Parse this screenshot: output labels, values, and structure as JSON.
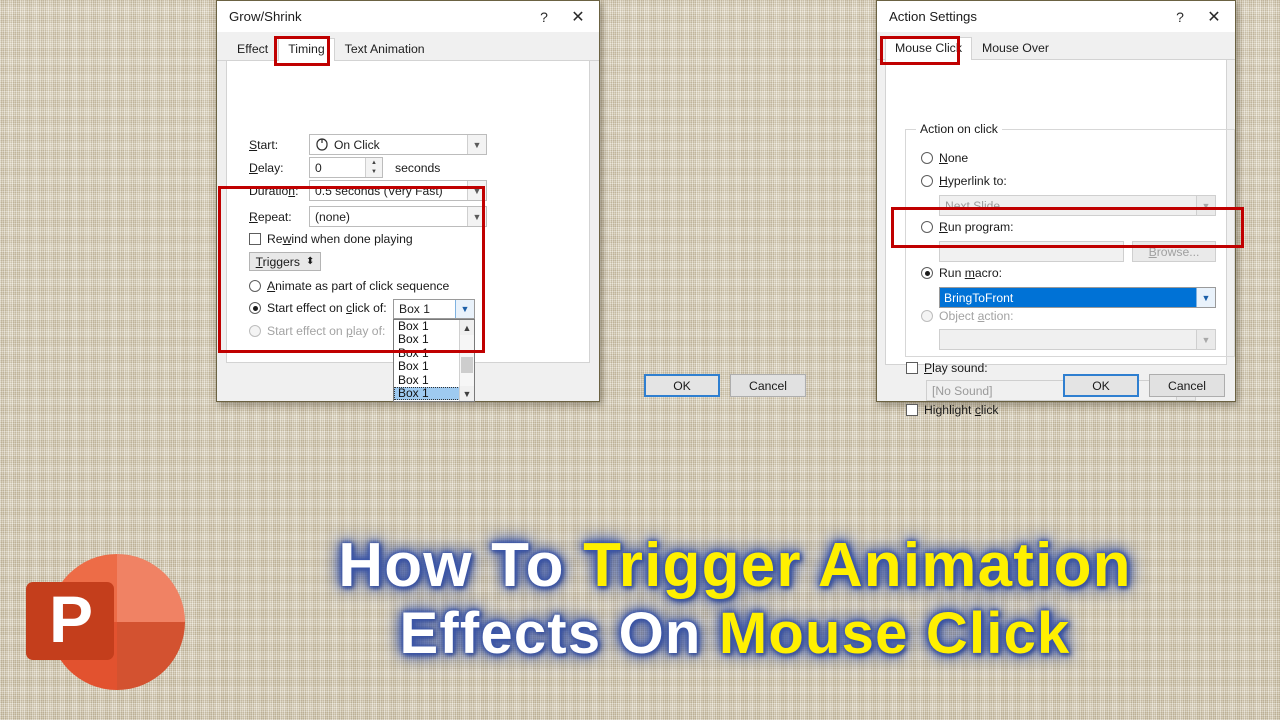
{
  "background": {
    "color": "#d7cdb6",
    "texture": "linen-burlap"
  },
  "dialog_grow_shrink": {
    "title": "Grow/Shrink",
    "help_icon": "?",
    "close_icon": "✕",
    "tabs": [
      {
        "label": "Effect",
        "active": false
      },
      {
        "label": "Timing",
        "active": true
      },
      {
        "label": "Text Animation",
        "active": false
      }
    ],
    "fields": {
      "start_label": "Start:",
      "start_value": "On Click",
      "start_icon": "mouse-icon",
      "delay_label": "Delay:",
      "delay_value": "0",
      "delay_units": "seconds",
      "duration_label": "Duration:",
      "duration_value": "0.5 seconds (Very Fast)",
      "repeat_label": "Repeat:",
      "repeat_value": "(none)",
      "rewind_label": "Rewind when done playing",
      "rewind_checked": false
    },
    "triggers": {
      "button_label": "Triggers",
      "button_glyph": "⬍",
      "option_sequence": "Animate as part of click sequence",
      "option_sequence_selected": false,
      "option_click_of": "Start effect on click of:",
      "option_click_of_selected": true,
      "click_of_value": "Box 1",
      "option_play_of": "Start effect on play of:",
      "option_play_of_selected": false,
      "option_play_of_disabled": true,
      "dropdown_items": [
        "Box 1",
        "Box 1",
        "Box 1",
        "Box 1",
        "Box 1",
        "Box 1"
      ],
      "dropdown_selected_index": 5
    },
    "buttons": {
      "ok": "OK",
      "cancel": "Cancel"
    },
    "highlight_color": "#c00000"
  },
  "dialog_action_settings": {
    "title": "Action Settings",
    "help_icon": "?",
    "close_icon": "✕",
    "tabs": [
      {
        "label": "Mouse Click",
        "active": true
      },
      {
        "label": "Mouse Over",
        "active": false
      }
    ],
    "group_caption": "Action on click",
    "options": {
      "none_label": "None",
      "none_selected": false,
      "hyperlink_label": "Hyperlink to:",
      "hyperlink_selected": false,
      "hyperlink_value": "Next Slide",
      "run_program_label": "Run program:",
      "run_program_selected": false,
      "run_program_value": "",
      "browse_label": "Browse...",
      "run_macro_label": "Run macro:",
      "run_macro_selected": true,
      "run_macro_value": "BringToFront",
      "object_action_label": "Object action:",
      "object_action_selected": false,
      "object_action_value": ""
    },
    "play_sound_label": "Play sound:",
    "play_sound_checked": false,
    "play_sound_value": "[No Sound]",
    "highlight_click_label": "Highlight click",
    "highlight_click_checked": false,
    "buttons": {
      "ok": "OK",
      "cancel": "Cancel"
    },
    "highlight_color": "#c00000"
  },
  "branding": {
    "logo": "powerpoint-logo",
    "logo_letter": "P",
    "logo_colors": {
      "light": "#f08264",
      "mid": "#ed6c47",
      "dark": "#d35230",
      "tile": "#c43e1c"
    }
  },
  "title_card": {
    "line1_part1": "How To ",
    "line1_part2": "Trigger Animation",
    "line2_part1": "Effects On ",
    "line2_part2": "Mouse Click",
    "white": "#ffffff",
    "yellow": "#fff000",
    "glow": "#3b56a8"
  }
}
